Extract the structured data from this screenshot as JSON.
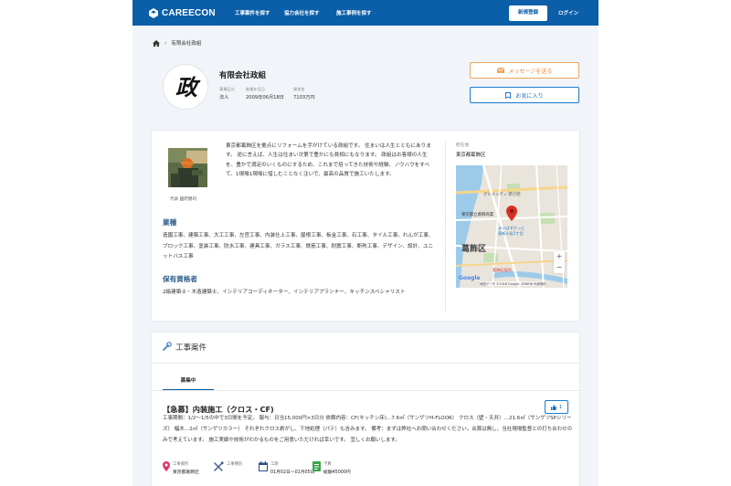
{
  "header": {
    "brand": "CAREECON",
    "nav": [
      "工事案件を探す",
      "協力会社を探す",
      "施工事例を探す"
    ],
    "register_label": "新規登録",
    "login_label": "ログイン",
    "color": "#0b5ea8"
  },
  "breadcrumb": {
    "current": "有限会社政組"
  },
  "company": {
    "avatar_char": "政",
    "name": "有限会社政組",
    "meta": [
      {
        "label": "事業区分",
        "value": "法人"
      },
      {
        "label": "創業年月日",
        "value": "2009年06月18日"
      },
      {
        "label": "資本金",
        "value": "7103万円"
      }
    ],
    "message_label": "メッセージを送る",
    "favorite_label": "お気に入り"
  },
  "profile": {
    "rep_name": "代表 國府健司",
    "intro": "東京都葛飾区を拠点にリフォームを手がけている政組です。 住まいは人生とともにあります。 逆に言えば、人生は住まい次第で豊かにも貧相にもなります。 政組はお客様の人生を、豊かで満足のいくものにするため、これまで培ってきた技術や経験、ノウハウをすべて、1現場1現場に惜しむことなく注いで、最高の品質で施工いたします。",
    "trades_title": "業種",
    "trades": "造園工事、建築工事、大工工事、左官工事、内装仕上工事、屋根工事、板金工事、石工事、タイル工事、れんが工事、ブロック工事、塗装工事、防水工事、建具工事、ガラス工事、鉄筋工事、耐震工事、断熱工事、デザイン、設計、ユニットバス工事",
    "quals_title": "保有資格者",
    "quals": "2級建築士・木造建築士、インテリアコーディネーター、インテリアプランナー、キッチンスペシャリスト",
    "location_label": "所在地",
    "location": "東京都葛飾区"
  },
  "map": {
    "label_big": "葛飾区",
    "label_station": "東京都立葛飾商業",
    "label_area": "葛飾区役所",
    "label_north": "東京都葛飾区",
    "label_gourmet": "グルメシティ 新小岩",
    "label_matsu": "まいばすけっと\n東新小岩1丁目",
    "copyright": "地図データ ©2018 Google, ZENRIN 利用規約",
    "google": "Google",
    "zoom_in": "+",
    "zoom_out": "−",
    "pin_color": "#d93025"
  },
  "works": {
    "title": "工事案件",
    "tab": "募集中",
    "job_title": "【急募】内装施工（クロス・CF)",
    "likes": "1",
    "desc": "工事期間：1/2〜1/5の中で3日間を予定。 報与：日当15,000円×3日分 依頼内容：CF(キッチン床)…7.6㎡（サンゲツH-FLOOR） クロス（壁・天井）…21.6㎡（サンゲツSPシリーズ） 幅木…2㎡（サンゲツカラー） それぞれクロス剥がし、下地処理（パテ）も含みます。 備考：まずは弊社へお問い合わせください。合算は無し、当社現場監督との打ち合わせのみで考えています。 施工実績や技術がわかるものをご用意いただければ幸いです。 宜しくお願いします。",
    "facts": [
      {
        "label": "工事場所",
        "value": "東京都葛飾区"
      },
      {
        "label": "工事種別",
        "value": ""
      },
      {
        "label": "工期",
        "value": "01月02日〜01月05日"
      },
      {
        "label": "予算",
        "value": "総額45000円"
      }
    ]
  }
}
